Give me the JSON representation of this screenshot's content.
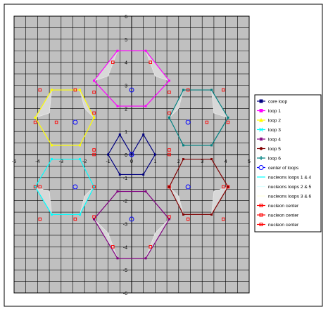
{
  "chart_data": {
    "type": "scatter",
    "title": "",
    "xlabel": "",
    "ylabel": "",
    "xlim": [
      -5,
      5
    ],
    "ylim": [
      -6,
      6
    ],
    "x_ticks": [
      "-5",
      "-4",
      "-3",
      "-2",
      "-1",
      "0",
      "1",
      "2",
      "3",
      "4",
      "5"
    ],
    "y_ticks": [
      "-6",
      "-5",
      "-4",
      "-3",
      "-2",
      "-1",
      "0",
      "1",
      "2",
      "3",
      "4",
      "5",
      "6"
    ],
    "grid": true,
    "legend_position": "right",
    "colors": {
      "plot_background": "#c0c0c0",
      "grid": "#000000",
      "core_loop": "#000080",
      "loop_1": "#ff00ff",
      "loop_2": "#ffff00",
      "loop_3": "#00ffff",
      "loop_4": "#800080",
      "loop_5": "#800000",
      "loop_6": "#008080",
      "center_of_loops": "#0000ff",
      "nucleons": "#e8e8e8",
      "nucleon_center": "#ff0000"
    },
    "legend": [
      {
        "label": "core loop",
        "marker": "square",
        "color": "#000080"
      },
      {
        "label": "loop 1",
        "marker": "square",
        "color": "#ff00ff"
      },
      {
        "label": "loop 2",
        "marker": "triangle",
        "color": "#ffff00"
      },
      {
        "label": "loop 3",
        "marker": "x",
        "color": "#00ffff"
      },
      {
        "label": "loop 4",
        "marker": "star",
        "color": "#800080"
      },
      {
        "label": "loop 5",
        "marker": "dot",
        "color": "#800000"
      },
      {
        "label": "loop 6",
        "marker": "plus",
        "color": "#008080"
      },
      {
        "label": "center of loops",
        "marker": "circle",
        "color": "#0000ff"
      },
      {
        "label": "nucleons loops 1 & 4",
        "marker": "line",
        "color": "#00ffff"
      },
      {
        "label": "nucleons loops 2 & 5",
        "marker": "line",
        "color": "#e0ffff"
      },
      {
        "label": "nucleons loops 3 & 6",
        "marker": "line",
        "color": "#ffffe0"
      },
      {
        "label": "nucleon center",
        "marker": "open-square",
        "color": "#ff0000"
      },
      {
        "label": "nucleon center",
        "marker": "open-square",
        "color": "#ff0000"
      },
      {
        "label": "nucleon center",
        "marker": "open-square",
        "color": "#ff0000"
      }
    ],
    "series": [
      {
        "name": "core loop",
        "color": "#000080",
        "points": [
          [
            0,
            0
          ],
          [
            0.5,
            0.866
          ],
          [
            1,
            0
          ],
          [
            0.5,
            -0.866
          ],
          [
            -0.5,
            -0.866
          ],
          [
            -1,
            0
          ],
          [
            -0.5,
            0.866
          ],
          [
            0,
            0
          ]
        ]
      },
      {
        "name": "loop 1",
        "color": "#ff00ff",
        "points": [
          [
            -1.6,
            3.2
          ],
          [
            -0.6,
            4.5
          ],
          [
            0.6,
            4.5
          ],
          [
            1.6,
            3.2
          ],
          [
            0.6,
            2.1
          ],
          [
            -0.6,
            2.1
          ],
          [
            -1.6,
            3.2
          ]
        ]
      },
      {
        "name": "loop 2",
        "color": "#ffff00",
        "points": [
          [
            -4.1,
            1.6
          ],
          [
            -3.4,
            2.8
          ],
          [
            -2.2,
            2.8
          ],
          [
            -1.6,
            1.6
          ],
          [
            -2.2,
            0.4
          ],
          [
            -3.4,
            0.4
          ],
          [
            -4.1,
            1.6
          ]
        ]
      },
      {
        "name": "loop 3",
        "color": "#00ffff",
        "points": [
          [
            -4.1,
            -1.4
          ],
          [
            -3.4,
            -0.2
          ],
          [
            -2.2,
            -0.2
          ],
          [
            -1.6,
            -1.4
          ],
          [
            -2.2,
            -2.6
          ],
          [
            -3.4,
            -2.6
          ],
          [
            -4.1,
            -1.4
          ]
        ]
      },
      {
        "name": "loop 4",
        "color": "#800080",
        "points": [
          [
            -1.6,
            -2.8
          ],
          [
            -0.6,
            -1.6
          ],
          [
            0.6,
            -1.6
          ],
          [
            1.6,
            -2.8
          ],
          [
            0.6,
            -4.5
          ],
          [
            -0.6,
            -4.5
          ],
          [
            -1.6,
            -2.8
          ]
        ]
      },
      {
        "name": "loop 5",
        "color": "#800000",
        "points": [
          [
            1.6,
            -1.4
          ],
          [
            2.2,
            -0.2
          ],
          [
            3.4,
            -0.2
          ],
          [
            4.1,
            -1.4
          ],
          [
            3.4,
            -2.6
          ],
          [
            2.2,
            -2.6
          ],
          [
            1.6,
            -1.4
          ]
        ]
      },
      {
        "name": "loop 6",
        "color": "#008080",
        "points": [
          [
            1.6,
            1.6
          ],
          [
            2.2,
            2.8
          ],
          [
            3.4,
            2.8
          ],
          [
            4.1,
            1.6
          ],
          [
            3.4,
            0.4
          ],
          [
            2.2,
            0.4
          ],
          [
            1.6,
            1.6
          ]
        ]
      }
    ],
    "loop_centers": [
      [
        0,
        2.8
      ],
      [
        -2.4,
        1.4
      ],
      [
        -2.4,
        -1.4
      ],
      [
        0,
        -2.8
      ],
      [
        2.4,
        -1.4
      ],
      [
        2.4,
        1.4
      ],
      [
        0,
        0
      ]
    ],
    "nucleon_centers": [
      [
        -0.8,
        4.0
      ],
      [
        0.8,
        4.0
      ],
      [
        -1.6,
        2.7
      ],
      [
        1.6,
        2.7
      ],
      [
        -3.9,
        2.8
      ],
      [
        -3.2,
        1.4
      ],
      [
        -1.6,
        1.8
      ],
      [
        -1.6,
        0.2
      ],
      [
        -3.9,
        -1.4
      ],
      [
        -3.9,
        -2.8
      ],
      [
        -1.6,
        -1.4
      ],
      [
        -1.6,
        0.0
      ],
      [
        -0.8,
        -4.0
      ],
      [
        0.8,
        -4.0
      ],
      [
        -1.6,
        -2.7
      ],
      [
        1.6,
        -2.7
      ],
      [
        3.9,
        -1.4
      ],
      [
        3.9,
        -2.8
      ],
      [
        1.6,
        -1.4
      ],
      [
        1.6,
        0.0
      ],
      [
        3.9,
        2.8
      ],
      [
        3.2,
        1.4
      ],
      [
        1.6,
        1.8
      ],
      [
        1.6,
        0.2
      ],
      [
        -2.4,
        2.8
      ],
      [
        2.4,
        2.8
      ],
      [
        -2.4,
        -2.8
      ],
      [
        2.4,
        -2.8
      ],
      [
        -4.1,
        1.4
      ],
      [
        -4.1,
        -1.4
      ],
      [
        4.1,
        1.4
      ],
      [
        4.1,
        -1.4
      ]
    ],
    "nucleon_triangles": [
      [
        [
          -1.6,
          3.2
        ],
        [
          -0.6,
          4.5
        ],
        [
          -1.0,
          3.4
        ]
      ],
      [
        [
          0.6,
          4.5
        ],
        [
          1.6,
          3.2
        ],
        [
          1.0,
          3.4
        ]
      ],
      [
        [
          -4.1,
          1.6
        ],
        [
          -3.4,
          2.8
        ],
        [
          -3.5,
          1.8
        ]
      ],
      [
        [
          -2.2,
          2.8
        ],
        [
          -1.6,
          1.6
        ],
        [
          -2.0,
          2.0
        ]
      ],
      [
        [
          -4.1,
          -1.4
        ],
        [
          -3.4,
          -2.6
        ],
        [
          -3.5,
          -1.6
        ]
      ],
      [
        [
          -2.2,
          -2.6
        ],
        [
          -1.6,
          -1.4
        ],
        [
          -2.0,
          -1.8
        ]
      ],
      [
        [
          -1.6,
          -2.8
        ],
        [
          -0.6,
          -4.5
        ],
        [
          -1.0,
          -3.4
        ]
      ],
      [
        [
          0.6,
          -4.5
        ],
        [
          1.6,
          -2.8
        ],
        [
          1.0,
          -3.4
        ]
      ],
      [
        [
          4.1,
          -1.4
        ],
        [
          3.4,
          -2.6
        ],
        [
          3.5,
          -1.6
        ]
      ],
      [
        [
          2.2,
          -2.6
        ],
        [
          1.6,
          -1.4
        ],
        [
          2.0,
          -1.8
        ]
      ],
      [
        [
          4.1,
          1.6
        ],
        [
          3.4,
          2.8
        ],
        [
          3.5,
          1.8
        ]
      ],
      [
        [
          2.2,
          2.8
        ],
        [
          1.6,
          1.6
        ],
        [
          2.0,
          2.0
        ]
      ]
    ]
  }
}
